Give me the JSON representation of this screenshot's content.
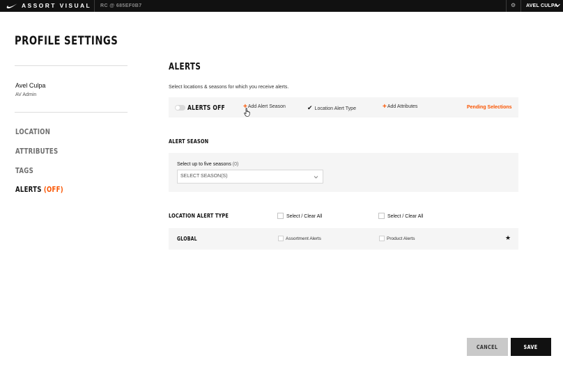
{
  "topbar": {
    "brand": "ASSORT VISUAL",
    "build": "RC @ 685EF0B7",
    "user": "AVEL CULPA"
  },
  "sidebar": {
    "page_title": "PROFILE SETTINGS",
    "user_name": "Avel Culpa",
    "user_role": "AV Admin",
    "nav": {
      "location": "LOCATION",
      "attributes": "ATTRIBUTES",
      "tags": "TAGS",
      "alerts": "ALERTS",
      "alerts_status": "(OFF)"
    }
  },
  "alerts": {
    "title": "ALERTS",
    "description": "Select locations & seasons for which you receive alerts.",
    "toggle_label": "ALERTS OFF",
    "add_alert_season": "Add Alert Season",
    "location_alert_type": "Location Alert Type",
    "add_attributes": "Add Attributes",
    "pending_selections": "Pending Selections"
  },
  "alert_season": {
    "heading": "ALERT SEASON",
    "label": "Select up to five seasons",
    "count": "(0)",
    "select_placeholder": "SELECT SEASON(S)"
  },
  "location_alert_type": {
    "heading": "LOCATION ALERT TYPE",
    "select_clear_1": "Select / Clear All",
    "select_clear_2": "Select / Clear All",
    "rows": [
      {
        "location": "GLOBAL",
        "assortment_alerts": "Assortment Alerts",
        "product_alerts": "Product Alerts"
      }
    ]
  },
  "footer": {
    "cancel": "CANCEL",
    "save": "SAVE"
  },
  "colors": {
    "accent": "#fa5400",
    "topbar": "#111111",
    "panel": "#f5f5f5",
    "cancel_bg": "#c9c9c9",
    "save_bg": "#111111"
  },
  "icons": {
    "brand_logo": "swoosh-icon",
    "settings": "gear-icon",
    "user_menu": "chevron-down-icon",
    "add": "plus-icon",
    "checked": "checkmark-icon",
    "dropdown": "chevron-down-icon",
    "favorite": "star-icon",
    "pointer": "hand-cursor-icon"
  }
}
